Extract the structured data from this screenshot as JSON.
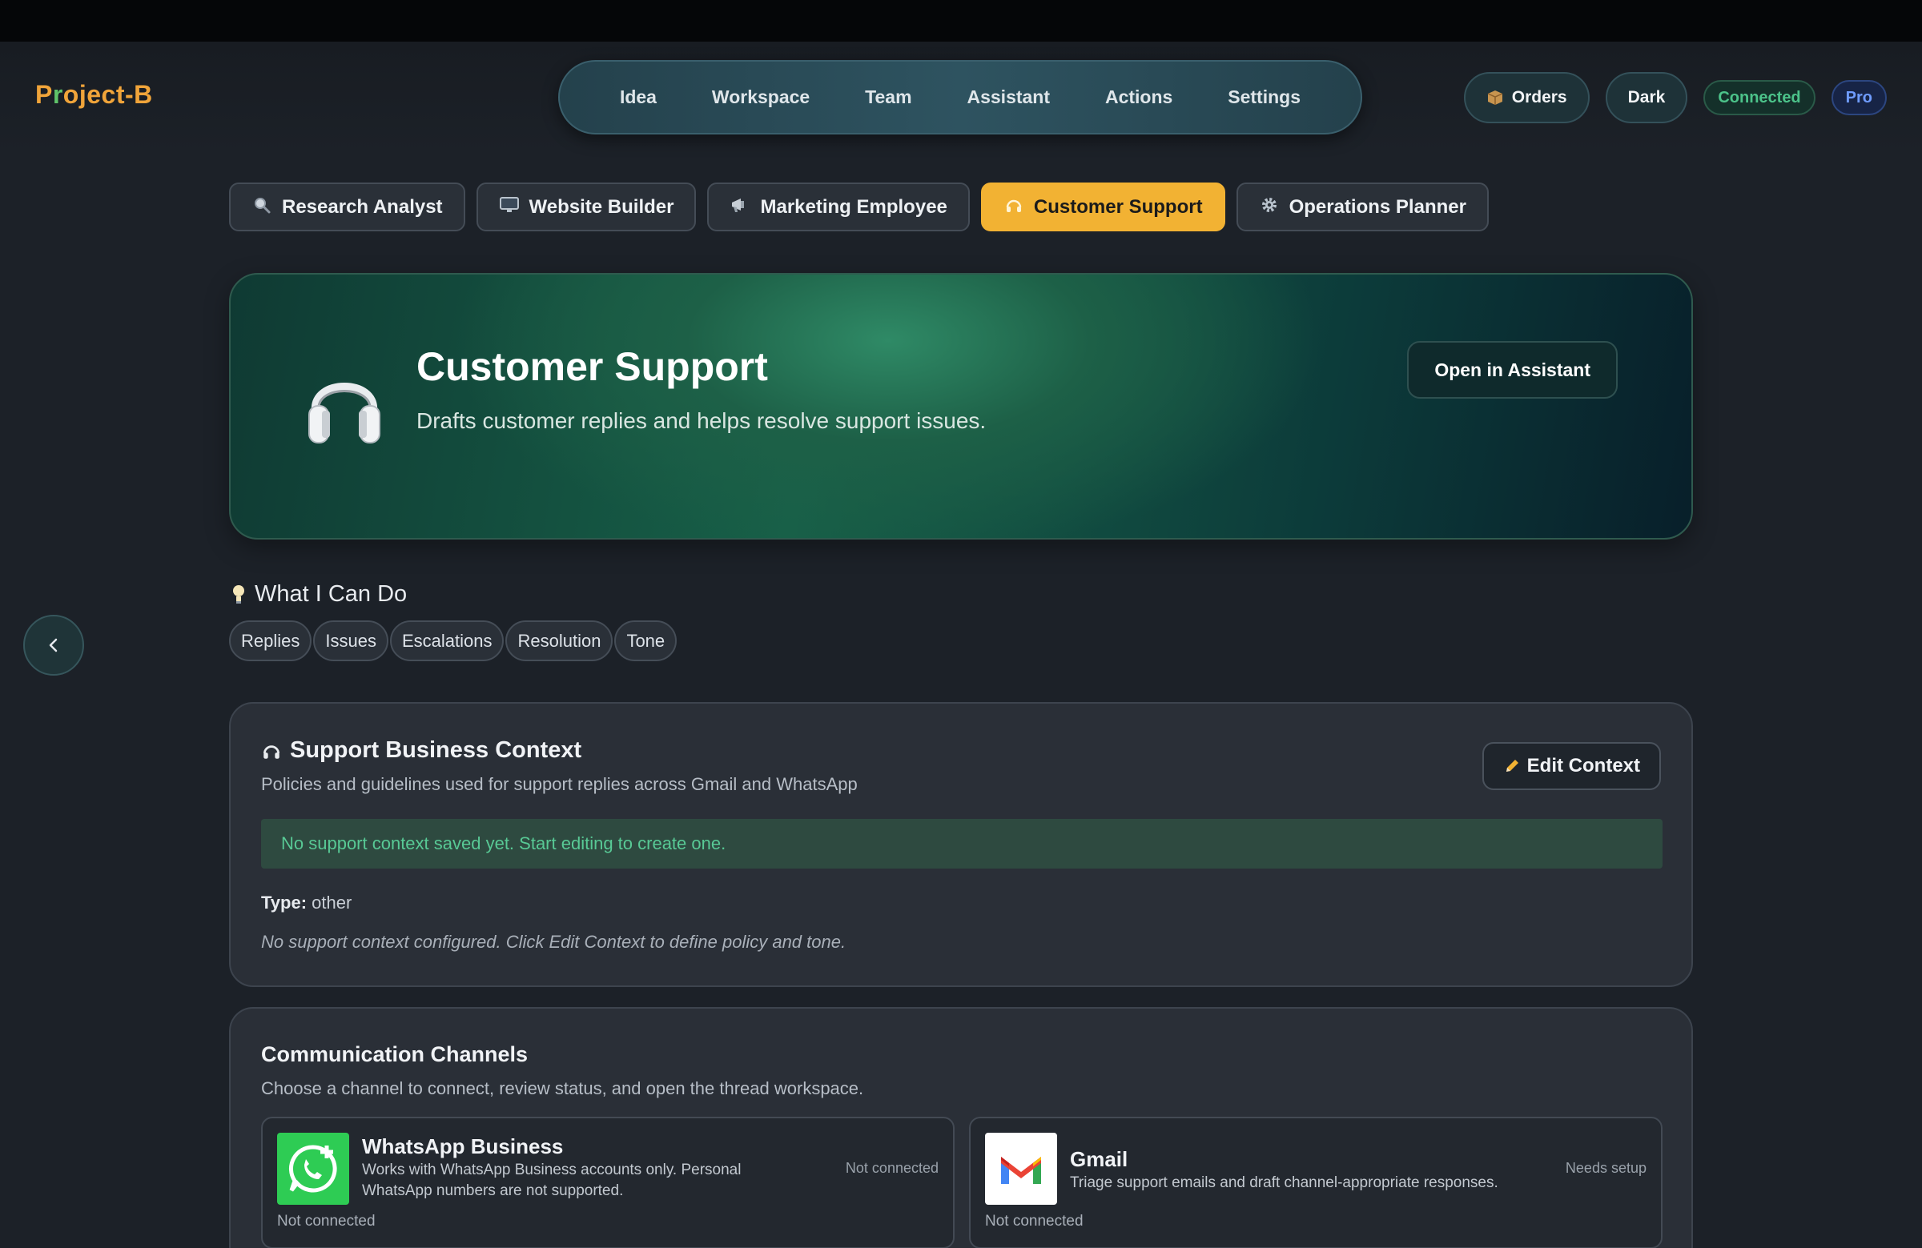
{
  "app": {
    "logo": "Project-B",
    "logo_parts": {
      "pre": "P",
      "leaf": "r",
      "post": "oject-B"
    }
  },
  "nav": {
    "items": [
      "Idea",
      "Workspace",
      "Team",
      "Assistant",
      "Actions",
      "Settings"
    ]
  },
  "header_right": {
    "orders_label": "Orders",
    "theme_label": "Dark",
    "status_badge": "Connected",
    "plan_badge": "Pro"
  },
  "roles": [
    {
      "label": "Research Analyst",
      "icon": "magnifier-icon"
    },
    {
      "label": "Website Builder",
      "icon": "monitor-icon"
    },
    {
      "label": "Marketing Employee",
      "icon": "megaphone-icon"
    },
    {
      "label": "Customer Support",
      "icon": "headphones-icon",
      "active": true
    },
    {
      "label": "Operations Planner",
      "icon": "gear-icon"
    }
  ],
  "hero": {
    "title": "Customer Support",
    "subtitle": "Drafts customer replies and helps resolve support issues.",
    "button": "Open in Assistant"
  },
  "capabilities": {
    "title": "What I Can Do",
    "tags": [
      "Replies",
      "Issues",
      "Escalations",
      "Resolution",
      "Tone"
    ]
  },
  "context_card": {
    "title": "Support Business Context",
    "subtitle": "Policies and guidelines used for support replies across Gmail and WhatsApp",
    "edit_button": "Edit Context",
    "notice": "No support context saved yet. Start editing to create one.",
    "type_label": "Type:",
    "type_value": "other",
    "empty_note": "No support context configured. Click Edit Context to define policy and tone."
  },
  "channels_card": {
    "title": "Communication Channels",
    "subtitle": "Choose a channel to connect, review status, and open the thread workspace.",
    "channels": [
      {
        "name": "WhatsApp Business",
        "description": "Works with WhatsApp Business accounts only. Personal WhatsApp numbers are not supported.",
        "state": "Not connected",
        "footer": "Not connected"
      },
      {
        "name": "Gmail",
        "description": "Triage support emails and draft channel-appropriate responses.",
        "state": "Needs setup",
        "footer": "Not connected"
      }
    ]
  },
  "colors": {
    "accent": "#f2b233",
    "success": "#4cc38a",
    "pro": "#6f9cff",
    "whatsapp": "#2ecc54"
  }
}
